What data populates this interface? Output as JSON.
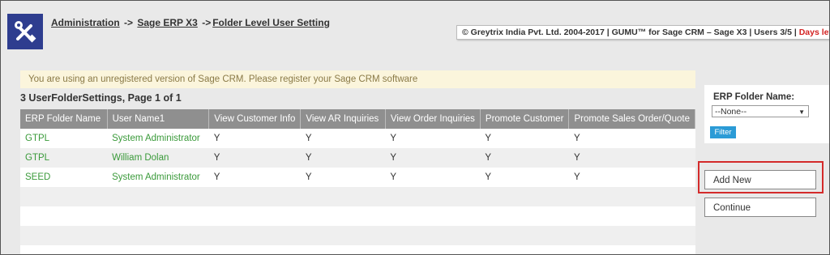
{
  "breadcrumb": {
    "items": [
      "Administration",
      "Sage ERP X3",
      "Folder Level User Setting"
    ],
    "sep1": "->",
    "sep2": "->"
  },
  "header": {
    "copyright": "© Greytrix India Pvt. Ltd. 2004-2017 | GUMU™ for Sage CRM – Sage X3 | Users 3/5 |",
    "days_left": "Days left"
  },
  "icons": {
    "logo": "tools-icon"
  },
  "warning": "You are using an unregistered version of Sage CRM. Please register your Sage CRM software",
  "results": {
    "title": "3 UserFolderSettings, Page 1 of 1",
    "columns": [
      "ERP Folder Name",
      "User Name1",
      "View Customer Info",
      "View AR Inquiries",
      "View Order Inquiries",
      "Promote Customer",
      "Promote Sales Order/Quote"
    ],
    "rows": [
      [
        "GTPL",
        "System Administrator",
        "Y",
        "Y",
        "Y",
        "Y",
        "Y"
      ],
      [
        "GTPL",
        "William Dolan",
        "Y",
        "Y",
        "Y",
        "Y",
        "Y"
      ],
      [
        "SEED",
        "System Administrator",
        "Y",
        "Y",
        "Y",
        "Y",
        "Y"
      ]
    ]
  },
  "filter_panel": {
    "label": "ERP Folder Name:",
    "select_value": "--None--",
    "filter_button": "Filter"
  },
  "actions": {
    "add_new": "Add New",
    "continue": "Continue"
  },
  "colors": {
    "header_bg": "#8f8f8f",
    "link_green": "#3a9a3a",
    "accent_blue": "#2b9bd6",
    "highlight_red": "#d42b2b"
  }
}
